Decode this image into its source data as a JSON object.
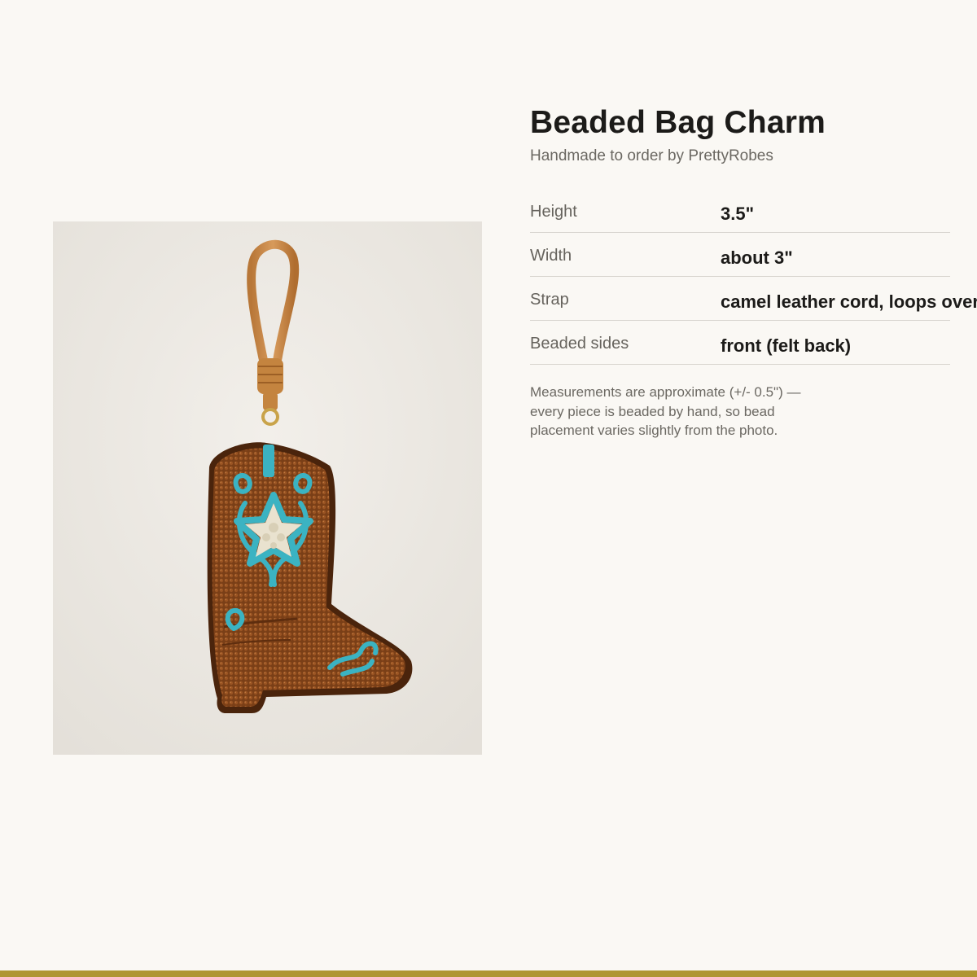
{
  "product": {
    "title": "Beaded Bag Charm",
    "subtitle": "Handmade to order by PrettyRobes",
    "photo_subject": "boot-charm-photo"
  },
  "specs": [
    {
      "label": "Height",
      "value": "3.5\""
    },
    {
      "label": "Width",
      "value": "about 3\""
    },
    {
      "label": "Strap",
      "value": "camel leather cord, loops over"
    },
    {
      "label": "Beaded sides",
      "value": "front (felt back)"
    }
  ],
  "footnote": "Measurements are approximate (+/- 0.5\") — every piece is beaded by hand, so bead placement varies slightly from the photo.",
  "colors": {
    "page_background": "#faf8f4",
    "accent_band": "#b09532",
    "boot_brown": "#8a4a1e",
    "bead_turquoise": "#3bb3c2",
    "leather_camel": "#c9894a"
  }
}
